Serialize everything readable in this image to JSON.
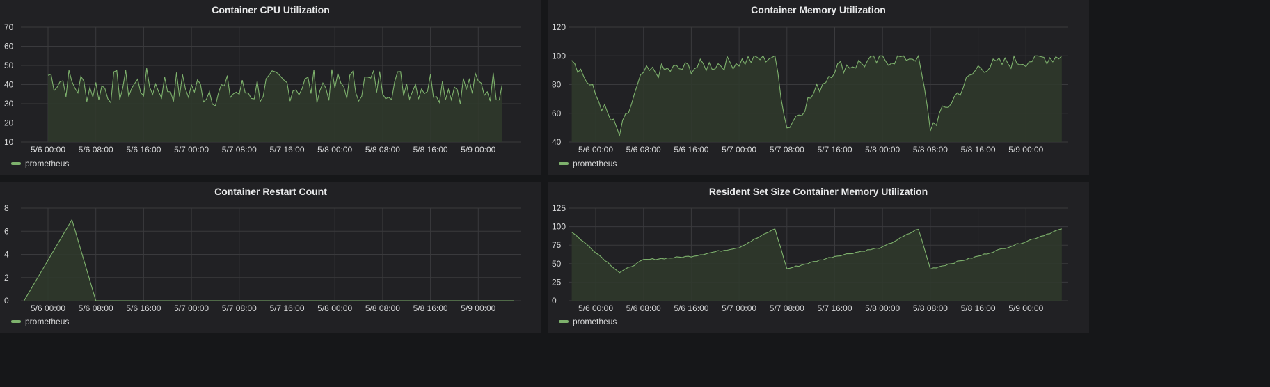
{
  "theme": {
    "background": "#161719",
    "panel": "#212124",
    "grid": "#3a3a3d",
    "series_color": "#7eb26d",
    "fill_color": "#2f3a2c"
  },
  "x_ticks": [
    "5/6 00:00",
    "5/6 08:00",
    "5/6 16:00",
    "5/7 00:00",
    "5/7 08:00",
    "5/7 16:00",
    "5/8 00:00",
    "5/8 08:00",
    "5/8 16:00",
    "5/9 00:00"
  ],
  "panels": [
    {
      "title": "Container CPU Utilization",
      "legend": "prometheus"
    },
    {
      "title": "Container Memory Utilization",
      "legend": "prometheus"
    },
    {
      "title": "Container Restart Count",
      "legend": "prometheus"
    },
    {
      "title": "Resident Set Size Container Memory Utilization",
      "legend": "prometheus"
    }
  ],
  "chart_data": [
    {
      "type": "line",
      "title": "Container CPU Utilization",
      "y_ticks": [
        10,
        20,
        30,
        40,
        50,
        60,
        70
      ],
      "ylim": [
        10,
        70
      ],
      "x": [
        "5/6 00:00",
        "5/6 04:00",
        "5/6 08:00",
        "5/6 16:00",
        "5/7 00:00",
        "5/7 08:00",
        "5/7 16:00",
        "5/8 00:00",
        "5/8 08:00",
        "5/8 16:00",
        "5/9 00:00",
        "5/9 04:00"
      ],
      "series": [
        {
          "name": "prometheus",
          "values": [
            45,
            40,
            38,
            40,
            38,
            36,
            40,
            39,
            41,
            40,
            38,
            40
          ]
        }
      ],
      "legend": "bottom-left"
    },
    {
      "type": "line",
      "title": "Container Memory Utilization",
      "y_ticks": [
        40,
        60,
        80,
        100,
        120
      ],
      "ylim": [
        40,
        120
      ],
      "x": [
        "5/5 20:00",
        "5/6 04:00",
        "5/6 08:00",
        "5/6 16:00",
        "5/7 00:00",
        "5/7 06:00",
        "5/7 08:00",
        "5/7 16:00",
        "5/8 00:00",
        "5/8 06:00",
        "5/8 08:00",
        "5/8 16:00",
        "5/9 00:00",
        "5/9 06:00"
      ],
      "series": [
        {
          "name": "prometheus",
          "values": [
            100,
            45,
            88,
            92,
            96,
            100,
            50,
            92,
            97,
            100,
            50,
            92,
            97,
            100
          ]
        }
      ],
      "legend": "bottom-left"
    },
    {
      "type": "line",
      "title": "Container Restart Count",
      "y_ticks": [
        0,
        2,
        4,
        6,
        8
      ],
      "ylim": [
        0,
        8
      ],
      "x": [
        "5/5 20:00",
        "5/6 04:00",
        "5/6 08:00",
        "5/7 08:00",
        "5/8 08:00",
        "5/9 06:00"
      ],
      "series": [
        {
          "name": "prometheus",
          "values": [
            0,
            7,
            0,
            0,
            0,
            0
          ]
        }
      ],
      "legend": "bottom-left"
    },
    {
      "type": "line",
      "title": "Resident Set Size Container Memory Utilization",
      "y_ticks": [
        0,
        25,
        50,
        75,
        100,
        125
      ],
      "ylim": [
        0,
        125
      ],
      "x": [
        "5/5 20:00",
        "5/6 04:00",
        "5/6 08:00",
        "5/6 16:00",
        "5/7 00:00",
        "5/7 06:00",
        "5/7 08:00",
        "5/7 16:00",
        "5/8 00:00",
        "5/8 06:00",
        "5/8 08:00",
        "5/8 16:00",
        "5/9 00:00",
        "5/9 06:00"
      ],
      "series": [
        {
          "name": "prometheus",
          "values": [
            93,
            38,
            55,
            60,
            72,
            97,
            43,
            60,
            72,
            97,
            43,
            60,
            80,
            97
          ]
        }
      ],
      "legend": "bottom-left"
    }
  ]
}
